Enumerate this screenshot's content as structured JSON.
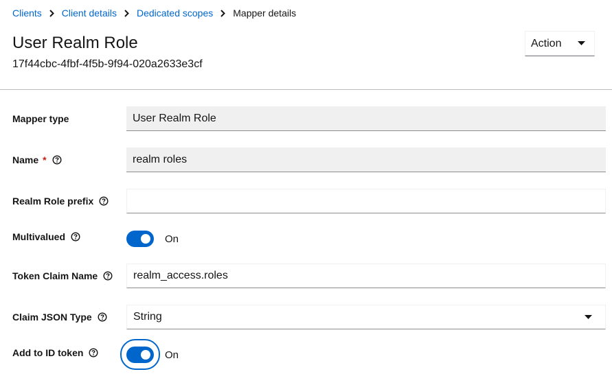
{
  "breadcrumb": {
    "items": [
      "Clients",
      "Client details",
      "Dedicated scopes"
    ],
    "current": "Mapper details"
  },
  "header": {
    "title": "User Realm Role",
    "id": "17f44cbc-4fbf-4f5b-9f94-020a2633e3cf",
    "action_label": "Action"
  },
  "form": {
    "mapper_type": {
      "label": "Mapper type",
      "value": "User Realm Role"
    },
    "name": {
      "label": "Name",
      "required_mark": "*",
      "value": "realm roles"
    },
    "realm_role_prefix": {
      "label": "Realm Role prefix",
      "value": ""
    },
    "multivalued": {
      "label": "Multivalued",
      "state": "On"
    },
    "token_claim_name": {
      "label": "Token Claim Name",
      "value": "realm_access.roles"
    },
    "claim_json_type": {
      "label": "Claim JSON Type",
      "value": "String"
    },
    "add_to_id_token": {
      "label": "Add to ID token",
      "state": "On"
    }
  },
  "colors": {
    "accent": "#0066cc",
    "required": "#c9190b",
    "readonly_bg": "#f0f0f0"
  },
  "icons": [
    "chevron-right-icon",
    "caret-down-icon",
    "help-icon"
  ]
}
